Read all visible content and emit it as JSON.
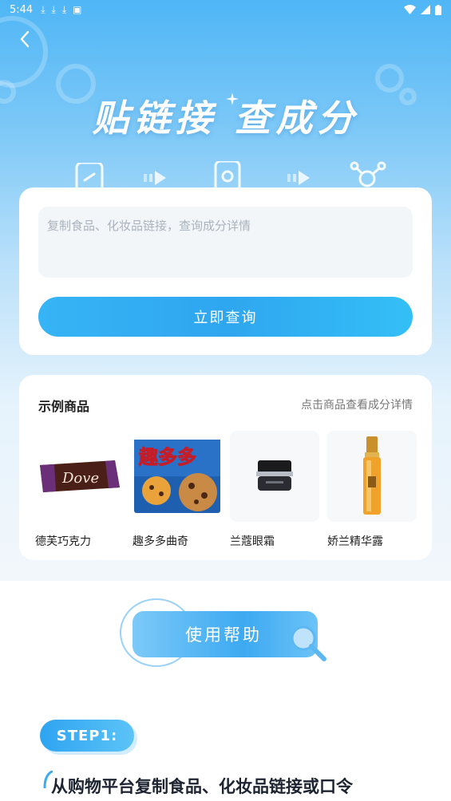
{
  "status_bar": {
    "time": "5:44"
  },
  "hero": {
    "title": "贴链接 查成分"
  },
  "search": {
    "placeholder": "复制食品、化妆品链接，查询成分详情",
    "query_button_label": "立即查询"
  },
  "examples": {
    "title": "示例商品",
    "hint": "点击商品查看成分详情",
    "items": [
      {
        "name": "德芙巧克力",
        "icon": "chocolate-bar-image"
      },
      {
        "name": "趣多多曲奇",
        "icon": "cookie-box-image"
      },
      {
        "name": "兰蔻眼霜",
        "icon": "eye-cream-jar-image"
      },
      {
        "name": "娇兰精华露",
        "icon": "serum-bottle-image"
      }
    ]
  },
  "help": {
    "banner_label": "使用帮助"
  },
  "steps": [
    {
      "badge": "STEP1:",
      "text": "从购物平台复制食品、化妆品链接或口令"
    }
  ],
  "colors": {
    "primary": "#2fa6f0",
    "hero_top": "#4fb6f6",
    "card_bg": "#ffffff",
    "input_bg": "#f3f6f9"
  }
}
